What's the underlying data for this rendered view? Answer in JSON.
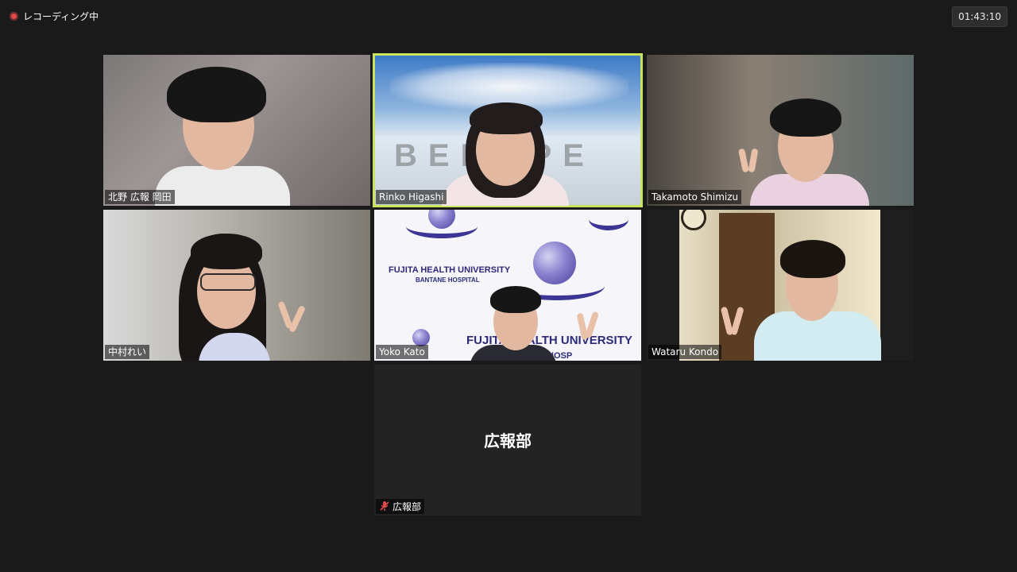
{
  "recording": {
    "label": "レコーディング中",
    "icon": "record-dot-icon"
  },
  "timer": {
    "value": "01:43:10"
  },
  "participants": [
    {
      "name": "北野 広報 岡田"
    },
    {
      "name": "Rinko Higashi",
      "active": true
    },
    {
      "name": "Takamoto Shimizu"
    },
    {
      "name": "中村れい"
    },
    {
      "name": "Yoko Kato"
    },
    {
      "name": "Wataru Kondo"
    },
    {
      "name": "広報部",
      "display_name": "広報部",
      "muted": true,
      "video_off": true
    }
  ],
  "logo_sheet": {
    "line1": "FUJITA HEALTH UNIVERSITY",
    "line2": "BANTANE HOSPITAL",
    "line3": "FUJITA HEALTH UNIVERSITY",
    "line4": "HOSP"
  },
  "backdrop_text": "BEHOPE",
  "colors": {
    "active_border": "#c9e35a",
    "background": "#1a1a1a",
    "record": "#e24b4b"
  }
}
